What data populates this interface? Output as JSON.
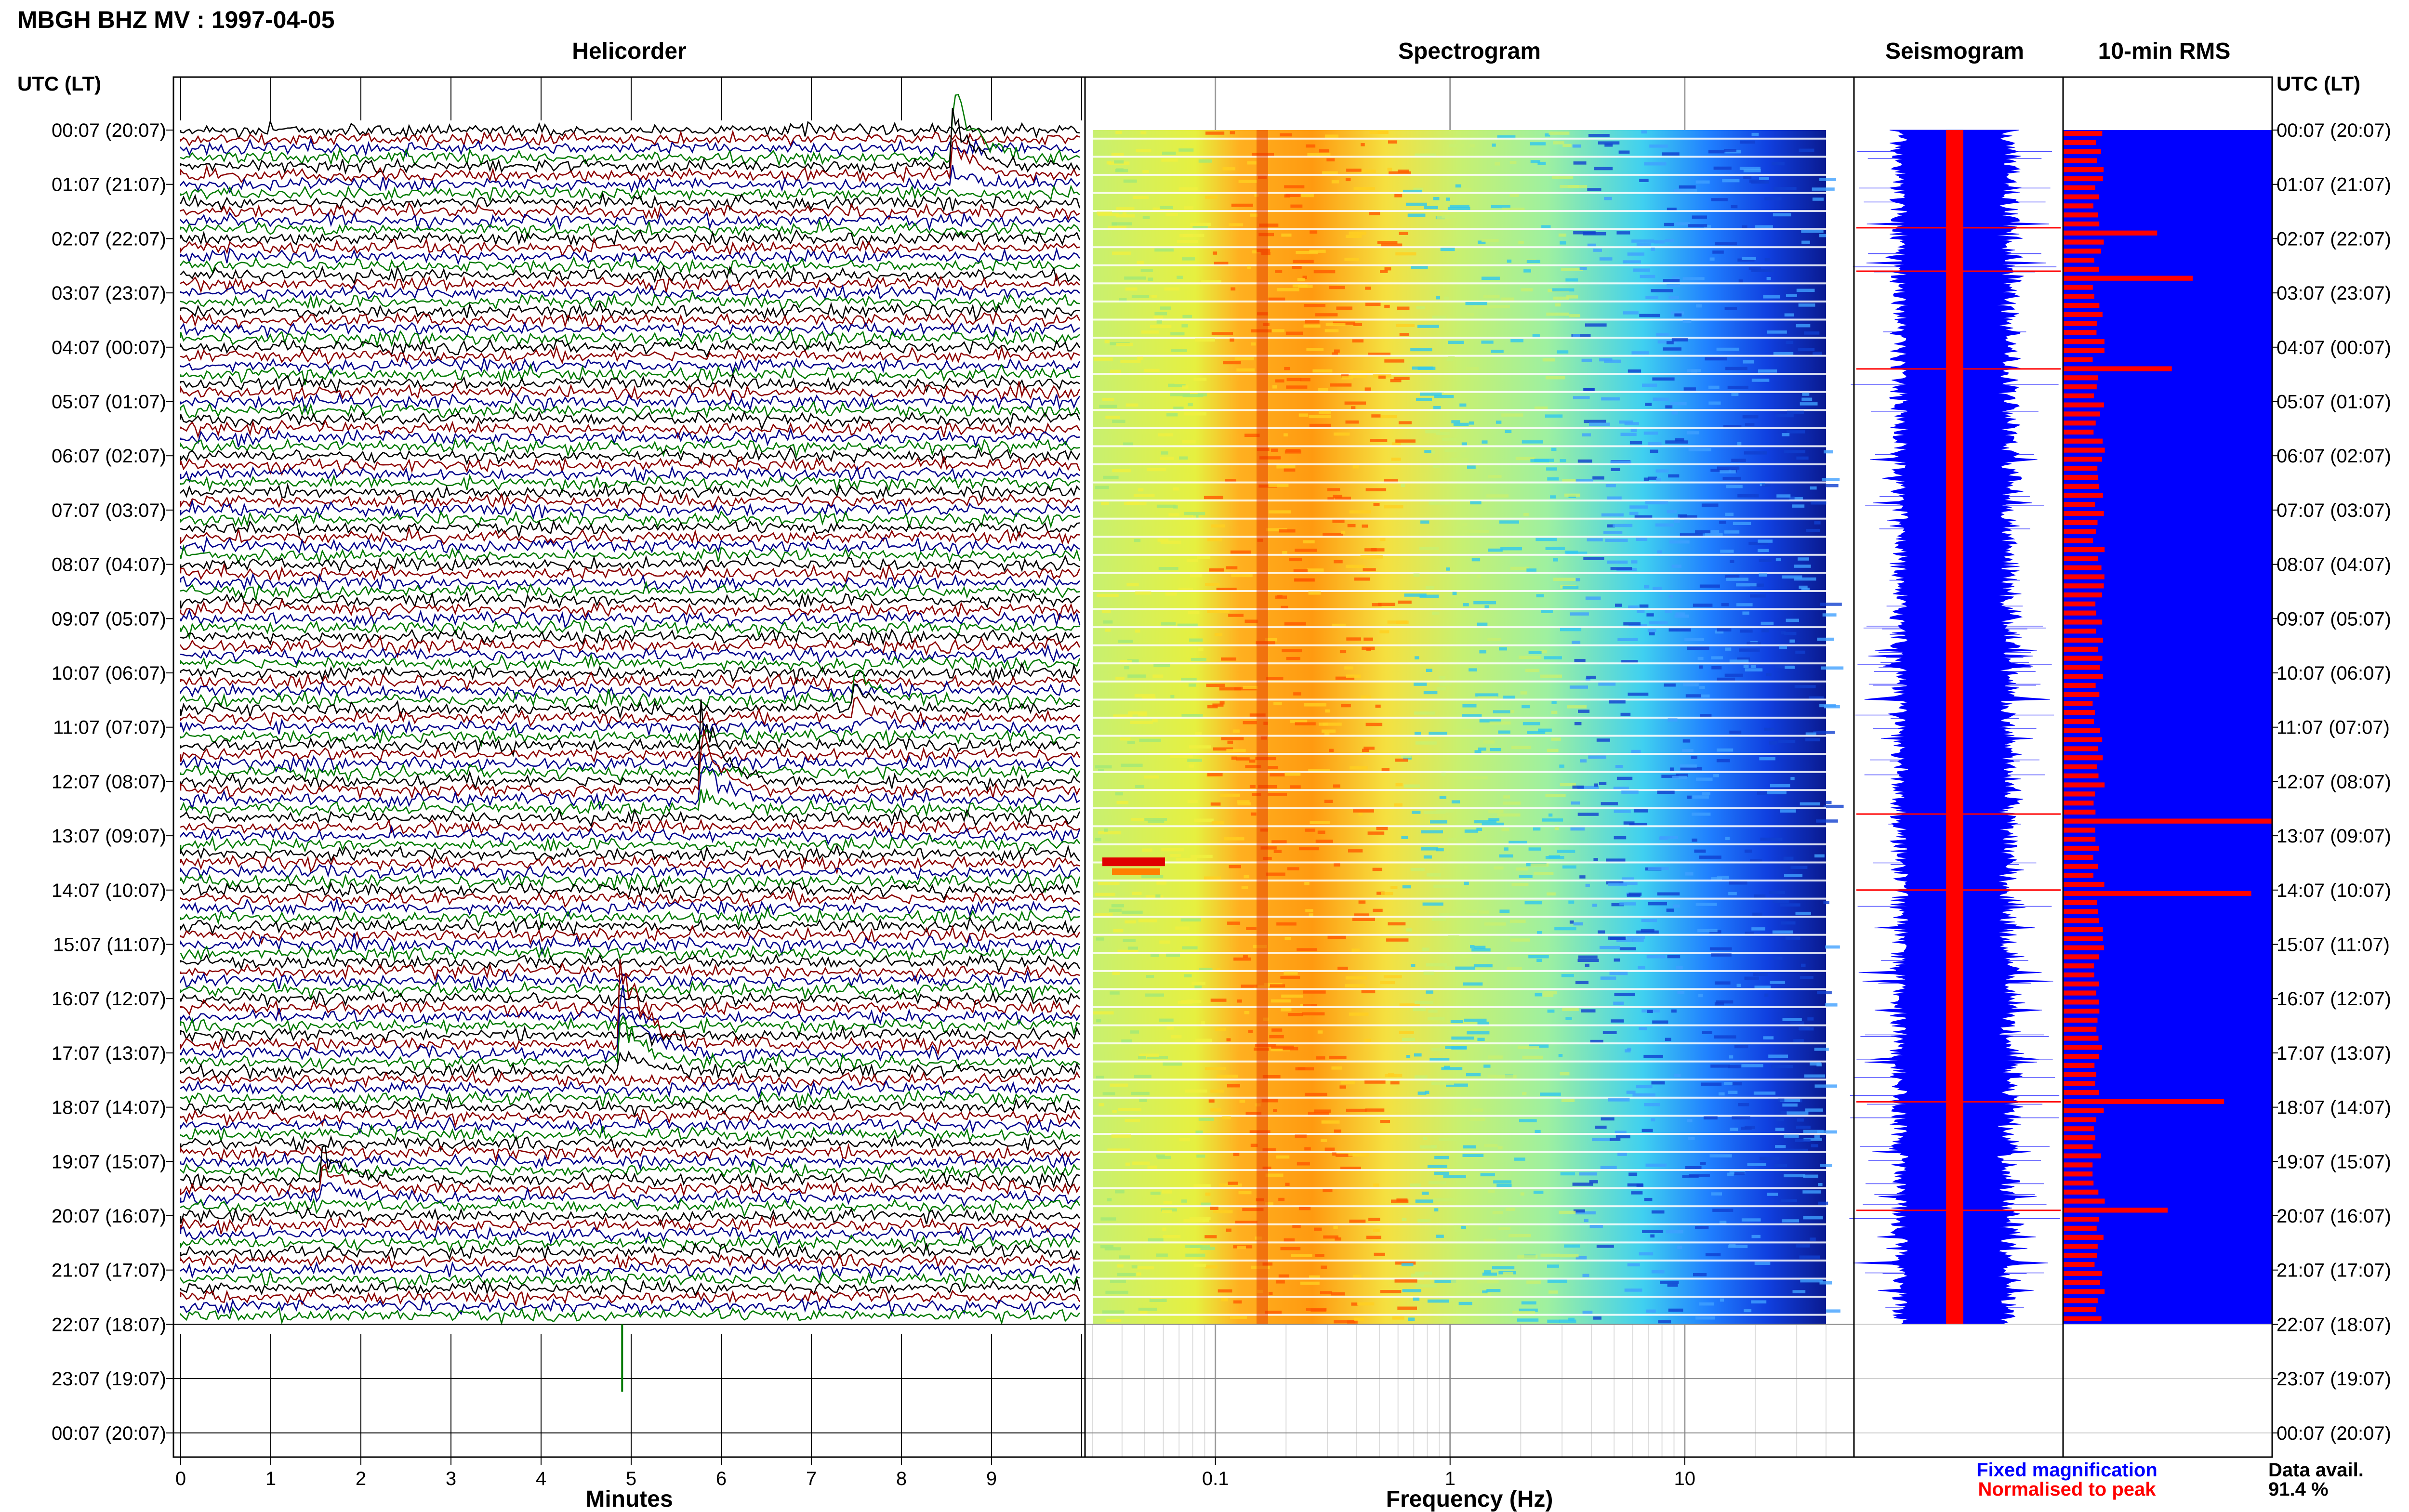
{
  "header": {
    "title": "MBGH BHZ MV : 1997-04-05"
  },
  "panels": {
    "helicorder": "Helicorder",
    "spectrogram": "Spectrogram",
    "seismogram": "Seismogram",
    "rms": "10-min RMS"
  },
  "axis": {
    "left_header": "UTC (LT)",
    "right_header": "UTC (LT)",
    "minutes_label": "Minutes",
    "frequency_label": "Frequency (Hz)"
  },
  "legend": {
    "fixed": "Fixed magnification",
    "normalised": "Normalised to peak",
    "fixed_color": "#0000ff",
    "normalised_color": "#ff0000"
  },
  "data_avail": {
    "label": "Data avail.",
    "value": "91.4 %"
  },
  "colors": {
    "trace_black": "#000000",
    "trace_red": "#8b0000",
    "trace_blue": "#00008b",
    "trace_green": "#007a00",
    "seis_blue": "#0000ff",
    "seis_red": "#ff0000",
    "rms_blue": "#0000ff",
    "rms_red": "#ff0000"
  },
  "chart_data": {
    "type": "heatmap",
    "time_labels": [
      "00:07 (20:07)",
      "01:07 (21:07)",
      "02:07 (22:07)",
      "03:07 (23:07)",
      "04:07 (00:07)",
      "05:07 (01:07)",
      "06:07 (02:07)",
      "07:07 (03:07)",
      "08:07 (04:07)",
      "09:07 (05:07)",
      "10:07 (06:07)",
      "11:07 (07:07)",
      "12:07 (08:07)",
      "13:07 (09:07)",
      "14:07 (10:07)",
      "15:07 (11:07)",
      "16:07 (12:07)",
      "17:07 (13:07)",
      "18:07 (14:07)",
      "19:07 (15:07)",
      "20:07 (16:07)",
      "21:07 (17:07)",
      "22:07 (18:07)",
      "23:07 (19:07)",
      "00:07 (20:07)"
    ],
    "minutes_ticks": [
      "0",
      "1",
      "2",
      "3",
      "4",
      "5",
      "6",
      "7",
      "8",
      "9"
    ],
    "frequency_ticks": [
      "0.1",
      "1",
      "10"
    ],
    "frequency_range": [
      0.03,
      40
    ],
    "data_hours": 22,
    "total_hours": 24,
    "events": [
      {
        "hour": 0.5,
        "minute": 8.6,
        "color": "green",
        "amp": 2.5
      },
      {
        "hour": 12.0,
        "minute": 5.8,
        "color": "red",
        "amp": 2.8
      },
      {
        "hour": 16.8,
        "minute": 4.9,
        "color": "green",
        "amp": 3.5
      },
      {
        "hour": 19.3,
        "minute": 1.6,
        "color": "green",
        "amp": 1.2
      },
      {
        "hour": 10.5,
        "minute": 7.5,
        "color": "green",
        "amp": 1.3
      }
    ],
    "rms_peaks": [
      {
        "hour": 1.8,
        "value": 0.45
      },
      {
        "hour": 2.6,
        "value": 0.62
      },
      {
        "hour": 4.4,
        "value": 0.52
      },
      {
        "hour": 12.6,
        "value": 1.0
      },
      {
        "hour": 14.0,
        "value": 0.9
      },
      {
        "hour": 17.9,
        "value": 0.77
      },
      {
        "hour": 19.9,
        "value": 0.5
      }
    ]
  }
}
